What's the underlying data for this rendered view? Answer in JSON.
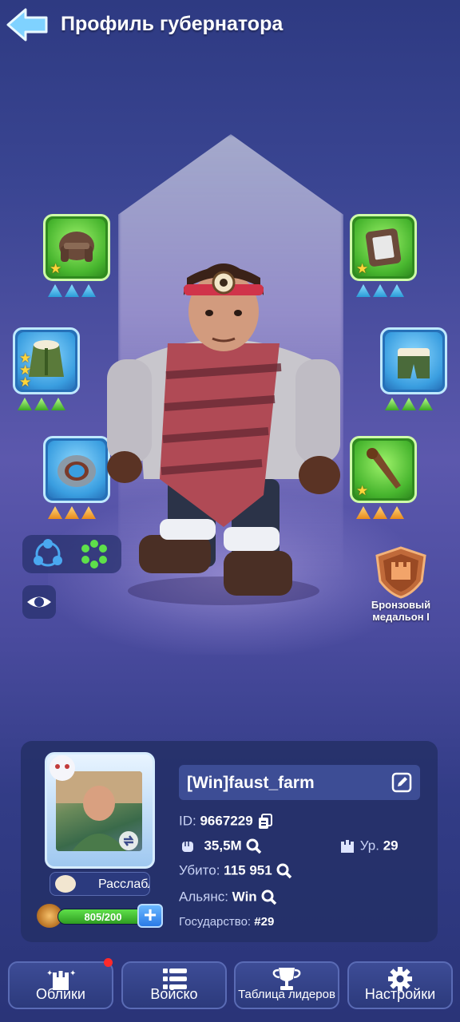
{
  "header": {
    "title": "Профиль губернатора"
  },
  "equipment": {
    "left": [
      {
        "item": "fur-hat",
        "stars": 1,
        "rank": "blue"
      },
      {
        "item": "fur-coat",
        "stars": 3,
        "rank": "green"
      },
      {
        "item": "metal-ring",
        "stars": 0,
        "rank": "orange"
      }
    ],
    "right": [
      {
        "item": "shield-badge",
        "stars": 1,
        "rank": "blue"
      },
      {
        "item": "fur-pants",
        "stars": 0,
        "rank": "green"
      },
      {
        "item": "wooden-club",
        "stars": 1,
        "rank": "orange"
      }
    ]
  },
  "medal": {
    "label": "Бронзовый медальон I"
  },
  "profile": {
    "name": "[Win]faust_farm",
    "id_label": "ID:",
    "id_value": "9667229",
    "power": "35,5M",
    "level_label": "Ур.",
    "level_value": "29",
    "kills_label": "Убито:",
    "kills_value": "115 951",
    "alliance_label": "Альянс:",
    "alliance_value": "Win",
    "state_label": "Государство:",
    "state_value": "#29",
    "status_text": "Расслабляюсь",
    "stamina_text": "805/200"
  },
  "nav": {
    "skins": "Облики",
    "army": "Войско",
    "leaderboard": "Таблица лидеров",
    "settings": "Настройки"
  },
  "colors": {
    "accent_green": "#47b52e",
    "accent_blue": "#3a9ee0",
    "panel": "#243068"
  }
}
